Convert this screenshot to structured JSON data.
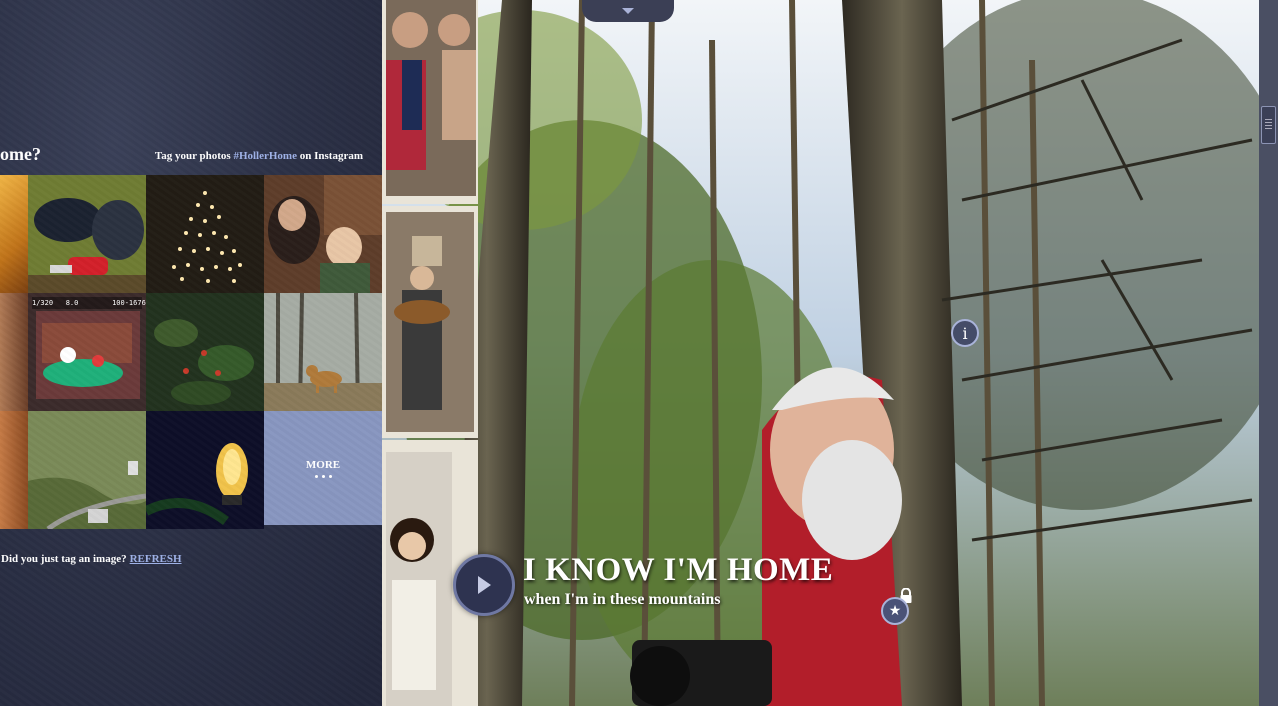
{
  "left": {
    "heading": "ome?",
    "tag_prefix": "Tag your photos ",
    "hashtag": "#HollerHome",
    "tag_suffix": " on Instagram",
    "more_label": "MORE",
    "refresh_prompt": "Did you just tag an image?",
    "refresh_link": "REFRESH"
  },
  "photo_overlay_text": "1/320   8.0        100-1676",
  "hero": {
    "title": "I KNOW I'M HOME",
    "subtitle": "when I'm in these mountains"
  },
  "icons": {
    "play": "play-icon",
    "info": "info-icon",
    "star": "star-icon",
    "lock": "lock-icon",
    "dropdown": "chevron-down-icon"
  },
  "colors": {
    "panel_bg": "#2c3146",
    "accent": "#9fb2e8",
    "more_tile": "#8896c0"
  }
}
